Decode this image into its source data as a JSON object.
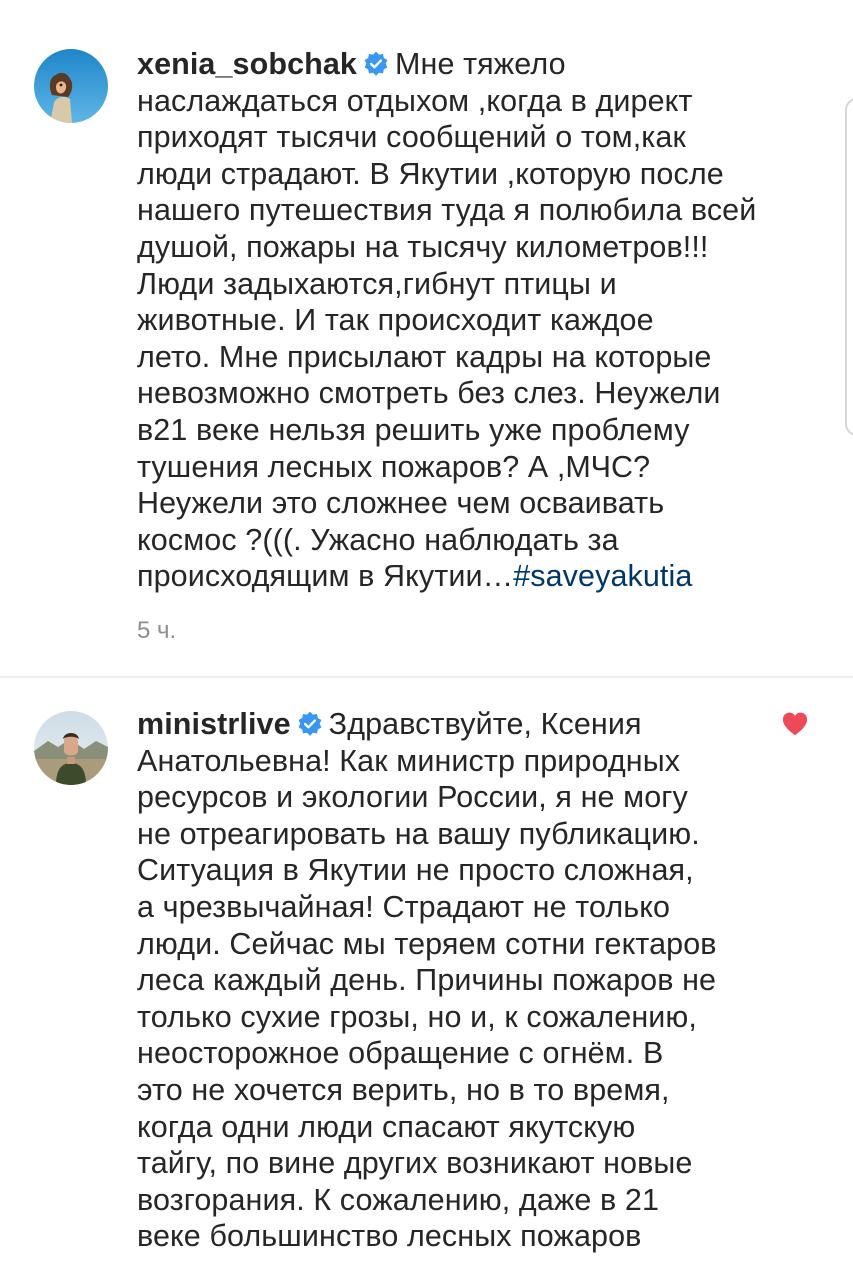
{
  "comments": [
    {
      "username": "xenia_sobchak",
      "verified": true,
      "lines": [
        "Мне тяжело",
        "наслаждаться отдыхом ,когда в директ",
        "приходят тысячи сообщений о том,как",
        "люди страдают. В Якутии ,которую после",
        "нашего путешествия туда я полюбила всей",
        "душой, пожары на тысячу километров!!!",
        "Люди задыхаются,гибнут птицы и",
        "животные. И так происходит каждое",
        "лето. Мне присылают кадры на которые",
        "невозможно смотреть без слез. Неужели",
        "в21 веке нельзя решить уже проблему",
        "тушения лесных пожаров? А ,МЧС?",
        "Неужели это сложнее чем осваивать",
        "космос ?(((. Ужасно наблюдать за",
        "происходящим в Якутии…"
      ],
      "hashtag": "#saveyakutia",
      "time": "5 ч.",
      "avatar_icon": "user-avatar-photo"
    },
    {
      "username": "ministrlive",
      "verified": true,
      "lines": [
        "Здравствуйте, Ксения",
        "Анатольевна! Как министр природных",
        "ресурсов и экологии России, я не могу",
        "не отреагировать на вашу публикацию.",
        "Ситуация в Якутии не просто сложная,",
        "а чрезвычайная! Страдают не только",
        "люди. Сейчас мы теряем сотни гектаров",
        "леса каждый день. Причины пожаров не",
        "только сухие грозы, но и, к сожалению,",
        "неосторожное обращение с огнём. В",
        "это не хочется верить, но в то время,",
        "когда одни люди спасают якутскую",
        "тайгу, по вине других возникают новые",
        "возгорания. К сожалению, даже в 21",
        "веке большинство лесных пожаров"
      ],
      "liked": true,
      "avatar_icon": "user-avatar-photo"
    }
  ],
  "colors": {
    "text": "#262626",
    "hashtag": "#00376b",
    "meta": "#8e8e8e",
    "verified": "#3897f0",
    "like": "#ed4956"
  }
}
